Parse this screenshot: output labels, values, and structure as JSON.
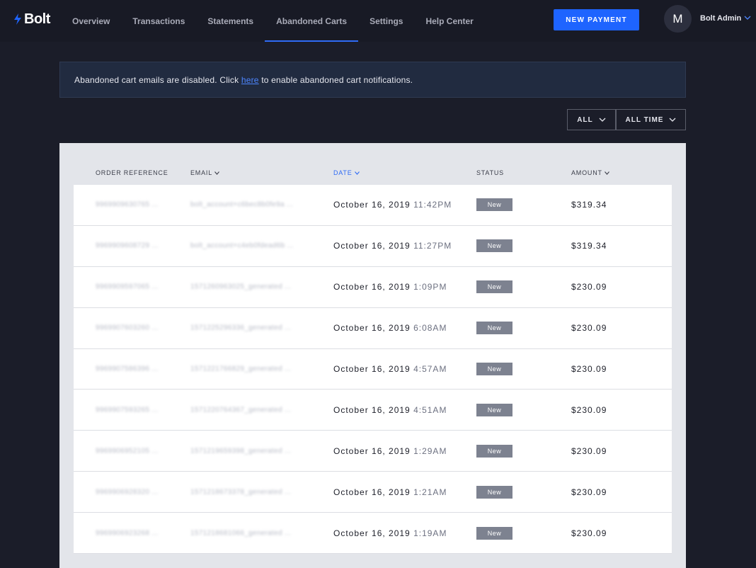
{
  "brand": {
    "name": "Bolt",
    "accent": "#1e64ff"
  },
  "nav": {
    "links": [
      {
        "label": "Overview"
      },
      {
        "label": "Transactions"
      },
      {
        "label": "Statements"
      },
      {
        "label": "Abandoned Carts",
        "active": true
      },
      {
        "label": "Settings"
      },
      {
        "label": "Help Center"
      }
    ],
    "new_payment_label": "NEW PAYMENT",
    "avatar_initial": "M",
    "user_name": "Bolt Admin"
  },
  "banner": {
    "text_before": "Abandoned cart emails are disabled. Click ",
    "link_text": "here",
    "text_after": " to enable abandoned cart notifications."
  },
  "filters": {
    "status_label": "ALL",
    "time_label": "ALL TIME"
  },
  "table": {
    "headers": {
      "order_reference": "ORDER REFERENCE",
      "email": "EMAIL",
      "date": "DATE",
      "status": "STATUS",
      "amount": "AMOUNT"
    },
    "rows": [
      {
        "ref": "9969909630765 ...",
        "email": "bolt_account+c6bec8b0fe9a ...",
        "date": "October 16, 2019",
        "time": "11:42PM",
        "status": "New",
        "amount": "$319.34"
      },
      {
        "ref": "9969909608729 ...",
        "email": "bolt_account+c4eb0fdead6b ...",
        "date": "October 16, 2019",
        "time": "11:27PM",
        "status": "New",
        "amount": "$319.34"
      },
      {
        "ref": "9969909597065 ...",
        "email": "1571260963025_generated ...",
        "date": "October 16, 2019",
        "time": "1:09PM",
        "status": "New",
        "amount": "$230.09"
      },
      {
        "ref": "9969907603260 ...",
        "email": "1571225296336_generated ...",
        "date": "October 16, 2019",
        "time": "6:08AM",
        "status": "New",
        "amount": "$230.09"
      },
      {
        "ref": "9969907586396 ...",
        "email": "1571221766829_generated ...",
        "date": "October 16, 2019",
        "time": "4:57AM",
        "status": "New",
        "amount": "$230.09"
      },
      {
        "ref": "9969907593265 ...",
        "email": "1571220764367_generated ...",
        "date": "October 16, 2019",
        "time": "4:51AM",
        "status": "New",
        "amount": "$230.09"
      },
      {
        "ref": "9969906952105 ...",
        "email": "1571219659398_generated ...",
        "date": "October 16, 2019",
        "time": "1:29AM",
        "status": "New",
        "amount": "$230.09"
      },
      {
        "ref": "9969906928320 ...",
        "email": "1571218673378_generated ...",
        "date": "October 16, 2019",
        "time": "1:21AM",
        "status": "New",
        "amount": "$230.09"
      },
      {
        "ref": "9969906923268 ...",
        "email": "1571218681066_generated ...",
        "date": "October 16, 2019",
        "time": "1:19AM",
        "status": "New",
        "amount": "$230.09"
      }
    ]
  }
}
